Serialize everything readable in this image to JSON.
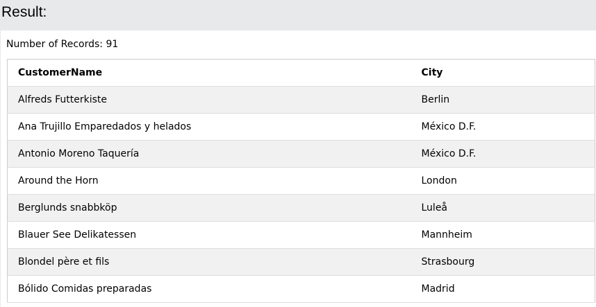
{
  "result": {
    "title": "Result:",
    "record_count_text": "Number of Records: 91"
  },
  "table": {
    "headers": [
      "CustomerName",
      "City"
    ],
    "rows": [
      [
        "Alfreds Futterkiste",
        "Berlin"
      ],
      [
        "Ana Trujillo Emparedados y helados",
        "México D.F."
      ],
      [
        "Antonio Moreno Taquería",
        "México D.F."
      ],
      [
        "Around the Horn",
        "London"
      ],
      [
        "Berglunds snabbköp",
        "Luleå"
      ],
      [
        "Blauer See Delikatessen",
        "Mannheim"
      ],
      [
        "Blondel père et fils",
        "Strasbourg"
      ],
      [
        "Bólido Comidas preparadas",
        "Madrid"
      ]
    ]
  },
  "colors": {
    "header_bar": "#e7e9eb",
    "row_stripe": "#f1f1f1",
    "row_plain": "#ffffff",
    "border": "#cccccc"
  }
}
